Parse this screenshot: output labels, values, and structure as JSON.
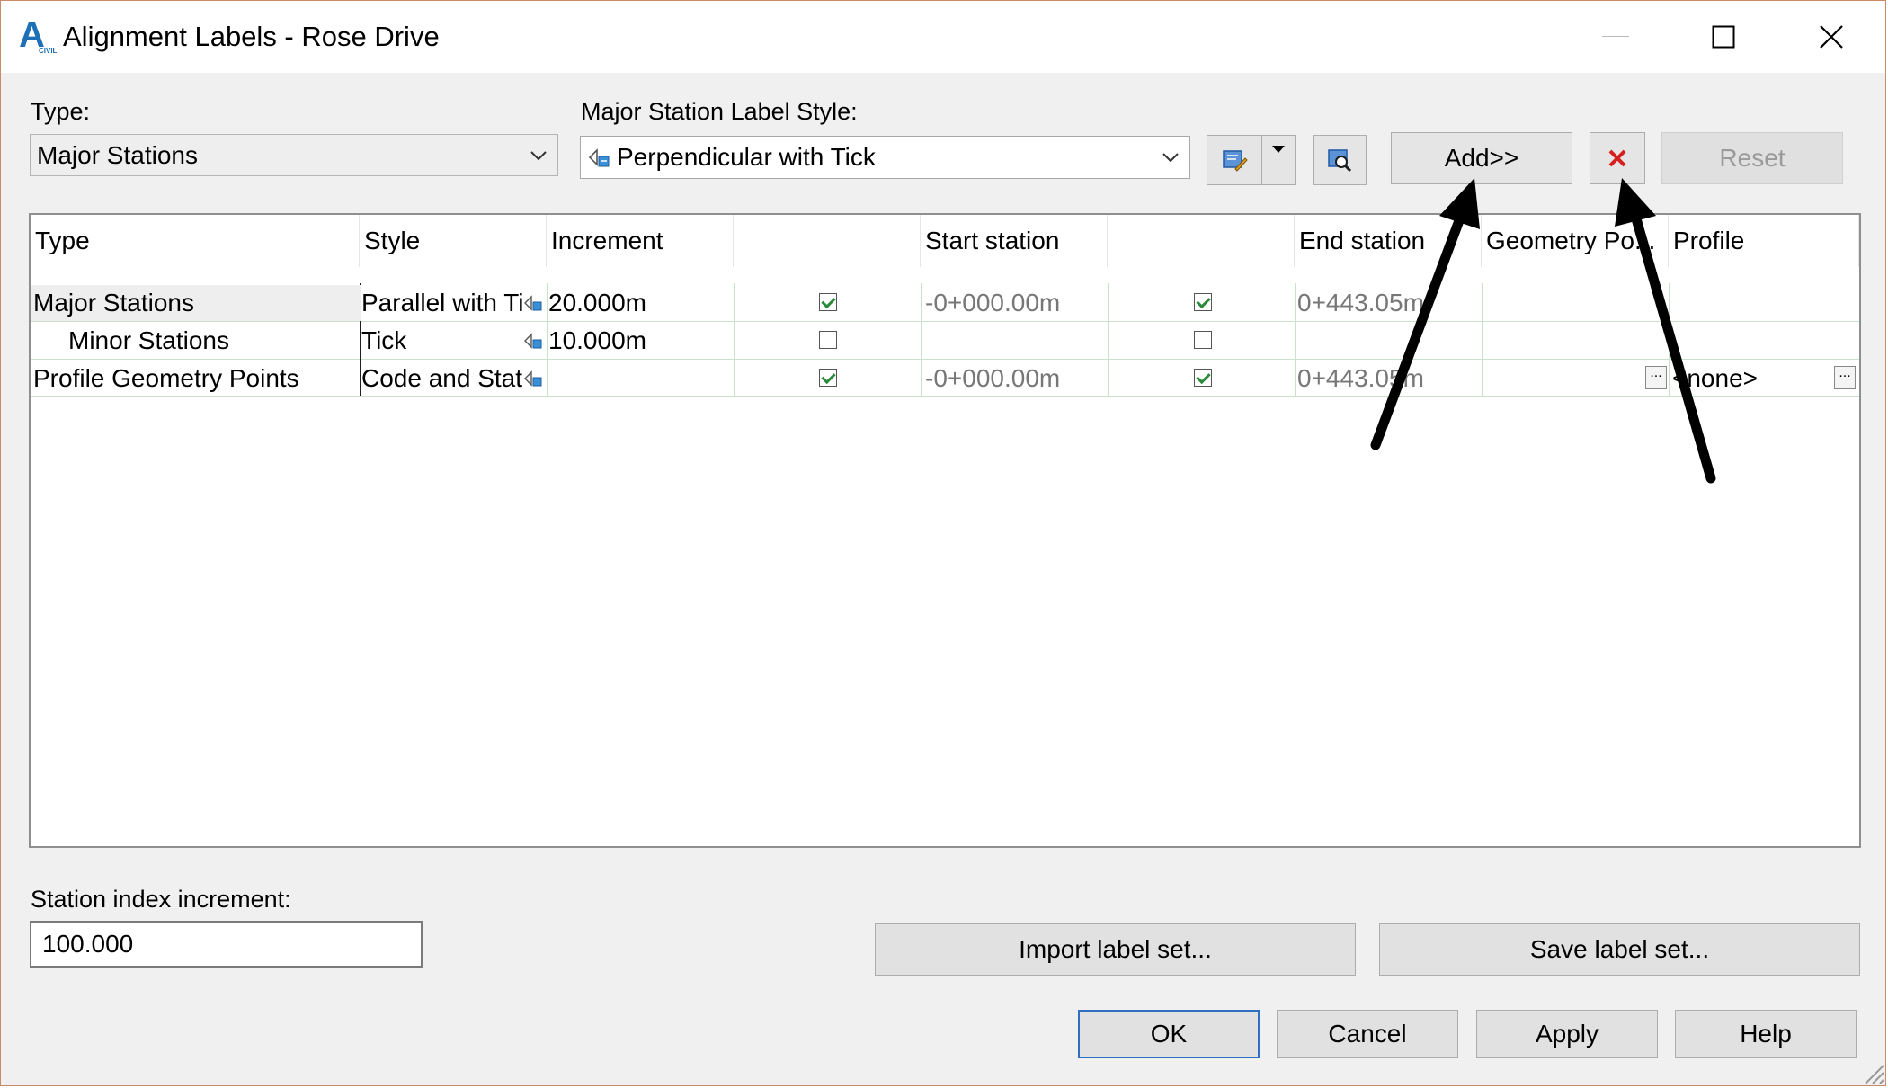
{
  "window": {
    "title": "Alignment Labels - Rose Drive",
    "app_icon_letter": "A",
    "app_icon_sub": "CIVIL",
    "controls": {
      "minimize": "minimize-icon",
      "maximize": "maximize-icon",
      "close": "close-icon"
    }
  },
  "type_field": {
    "label": "Type:",
    "value": "Major Stations"
  },
  "style_field": {
    "label": "Major Station Label Style:",
    "value": "Perpendicular with Tick"
  },
  "toolbar": {
    "edit_icon": "edit-style-icon",
    "dropdown_icon": "dropdown-arrow-icon",
    "preview_icon": "preview-icon",
    "add_label": "Add>>",
    "delete_icon": "delete-icon",
    "reset_label": "Reset"
  },
  "grid": {
    "columns": [
      "Type",
      "Style",
      "Increment",
      "",
      "Start station",
      "",
      "End station",
      "Geometry Po...",
      "Profile"
    ],
    "rows": [
      {
        "type": "Major Stations",
        "style": "Parallel with Ti",
        "increment": "20.000m",
        "start_checked": true,
        "start": "-0+000.00m",
        "end_checked": true,
        "end": "0+443.05m",
        "geometry": "",
        "profile": ""
      },
      {
        "type": "Minor Stations",
        "style": "Tick",
        "increment": "10.000m",
        "start_checked": false,
        "start": "",
        "end_checked": false,
        "end": "",
        "geometry": "",
        "profile": ""
      },
      {
        "type": "Profile Geometry Points",
        "style": "Code and Stati",
        "increment": "",
        "start_checked": true,
        "start": "-0+000.00m",
        "end_checked": true,
        "end": "0+443.05m",
        "geometry": "",
        "profile": "<none>"
      }
    ],
    "ellipsis": "..."
  },
  "station_index": {
    "label": "Station index increment:",
    "value": "100.000"
  },
  "buttons": {
    "import": "Import label set...",
    "save": "Save label set...",
    "ok": "OK",
    "cancel": "Cancel",
    "apply": "Apply",
    "help": "Help"
  },
  "colors": {
    "accent": "#2f6fbf",
    "delete_red": "#d62020",
    "grid_line": "#c9e2c9"
  }
}
